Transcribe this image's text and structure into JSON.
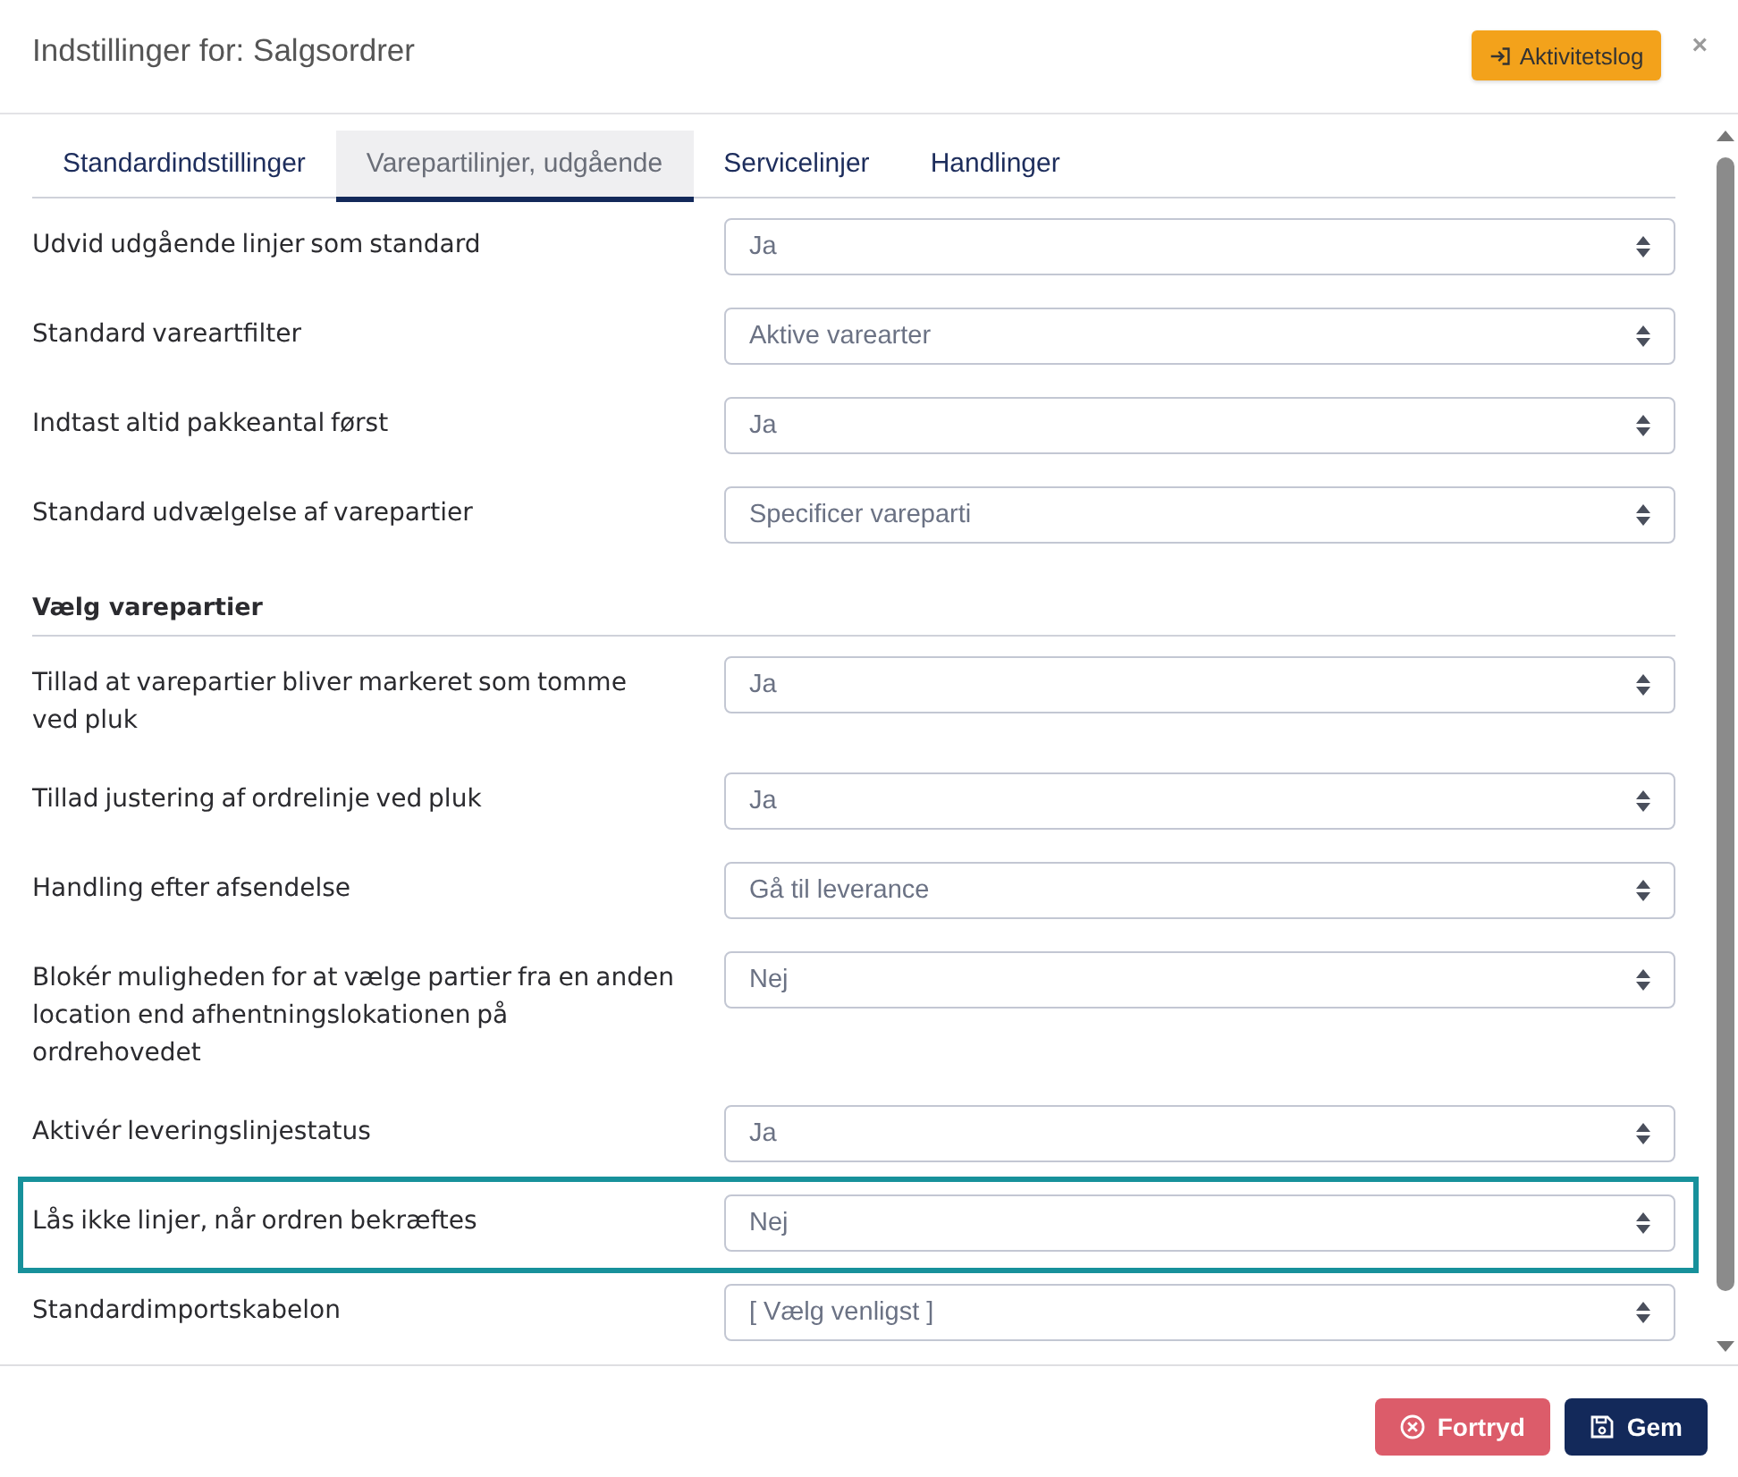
{
  "dialog": {
    "title": "Indstillinger for: Salgsordrer",
    "activity_button": {
      "label": "Aktivitetslog"
    },
    "close": "×"
  },
  "tabs": [
    {
      "label": "Standardindstillinger",
      "selected": false
    },
    {
      "label": "Varepartilinjer, udgående",
      "selected": true
    },
    {
      "label": "Servicelinjer",
      "selected": false
    },
    {
      "label": "Handlinger",
      "selected": false
    }
  ],
  "settings": [
    {
      "kind": "select",
      "label": "Udvid udgående linjer som standard",
      "value": "Ja",
      "highlighted": false
    },
    {
      "kind": "select",
      "label": "Standard vareartfilter",
      "value": "Aktive varearter",
      "highlighted": false
    },
    {
      "kind": "select",
      "label": "Indtast altid pakkeantal først",
      "value": "Ja",
      "highlighted": false
    },
    {
      "kind": "select",
      "label": "Standard udvælgelse af varepartier",
      "value": "Specificer vareparti",
      "highlighted": false
    },
    {
      "kind": "section",
      "label": "Vælg varepartier"
    },
    {
      "kind": "select",
      "label": "Tillad at varepartier bliver markeret som tomme ved pluk",
      "value": "Ja",
      "highlighted": false
    },
    {
      "kind": "select",
      "label": "Tillad justering af ordrelinje ved pluk",
      "value": "Ja",
      "highlighted": false
    },
    {
      "kind": "select",
      "label": "Handling efter afsendelse",
      "value": "Gå til leverance",
      "highlighted": false
    },
    {
      "kind": "select",
      "label": "Blokér muligheden for at vælge partier fra en anden location end afhentningslokationen på ordrehovedet",
      "value": "Nej",
      "highlighted": false
    },
    {
      "kind": "select",
      "label": "Aktivér leveringslinjestatus",
      "value": "Ja",
      "highlighted": false
    },
    {
      "kind": "select",
      "label": "Lås ikke linjer, når ordren bekræftes",
      "value": "Nej",
      "highlighted": true
    },
    {
      "kind": "select",
      "label": "Standardimportskabelon",
      "value": "[ Vælg venligst ]",
      "highlighted": false
    }
  ],
  "footer": {
    "buttons": [
      {
        "kind": "cancel",
        "label": "Fortryd"
      },
      {
        "kind": "save",
        "label": "Gem"
      }
    ]
  }
}
